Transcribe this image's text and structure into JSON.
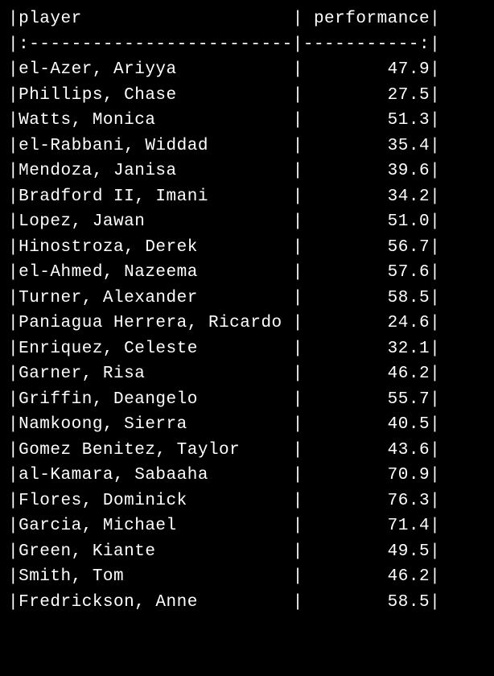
{
  "chart_data": {
    "type": "table",
    "headers": {
      "player": "player",
      "performance": "performance"
    },
    "col1_width": 26,
    "col2_width": 12,
    "rows": [
      {
        "player": "el-Azer, Ariyya",
        "performance": 47.9
      },
      {
        "player": "Phillips, Chase",
        "performance": 27.5
      },
      {
        "player": "Watts, Monica",
        "performance": 51.3
      },
      {
        "player": "el-Rabbani, Widdad",
        "performance": 35.4
      },
      {
        "player": "Mendoza, Janisa",
        "performance": 39.6
      },
      {
        "player": "Bradford II, Imani",
        "performance": 34.2
      },
      {
        "player": "Lopez, Jawan",
        "performance": 51.0
      },
      {
        "player": "Hinostroza, Derek",
        "performance": 56.7
      },
      {
        "player": "el-Ahmed, Nazeema",
        "performance": 57.6
      },
      {
        "player": "Turner, Alexander",
        "performance": 58.5
      },
      {
        "player": "Paniagua Herrera, Ricardo",
        "performance": 24.6
      },
      {
        "player": "Enriquez, Celeste",
        "performance": 32.1
      },
      {
        "player": "Garner, Risa",
        "performance": 46.2
      },
      {
        "player": "Griffin, Deangelo",
        "performance": 55.7
      },
      {
        "player": "Namkoong, Sierra",
        "performance": 40.5
      },
      {
        "player": "Gomez Benitez, Taylor",
        "performance": 43.6
      },
      {
        "player": "al-Kamara, Sabaaha",
        "performance": 70.9
      },
      {
        "player": "Flores, Dominick",
        "performance": 76.3
      },
      {
        "player": "Garcia, Michael",
        "performance": 71.4
      },
      {
        "player": "Green, Kiante",
        "performance": 49.5
      },
      {
        "player": "Smith, Tom",
        "performance": 46.2
      },
      {
        "player": "Fredrickson, Anne",
        "performance": 58.5
      }
    ]
  }
}
